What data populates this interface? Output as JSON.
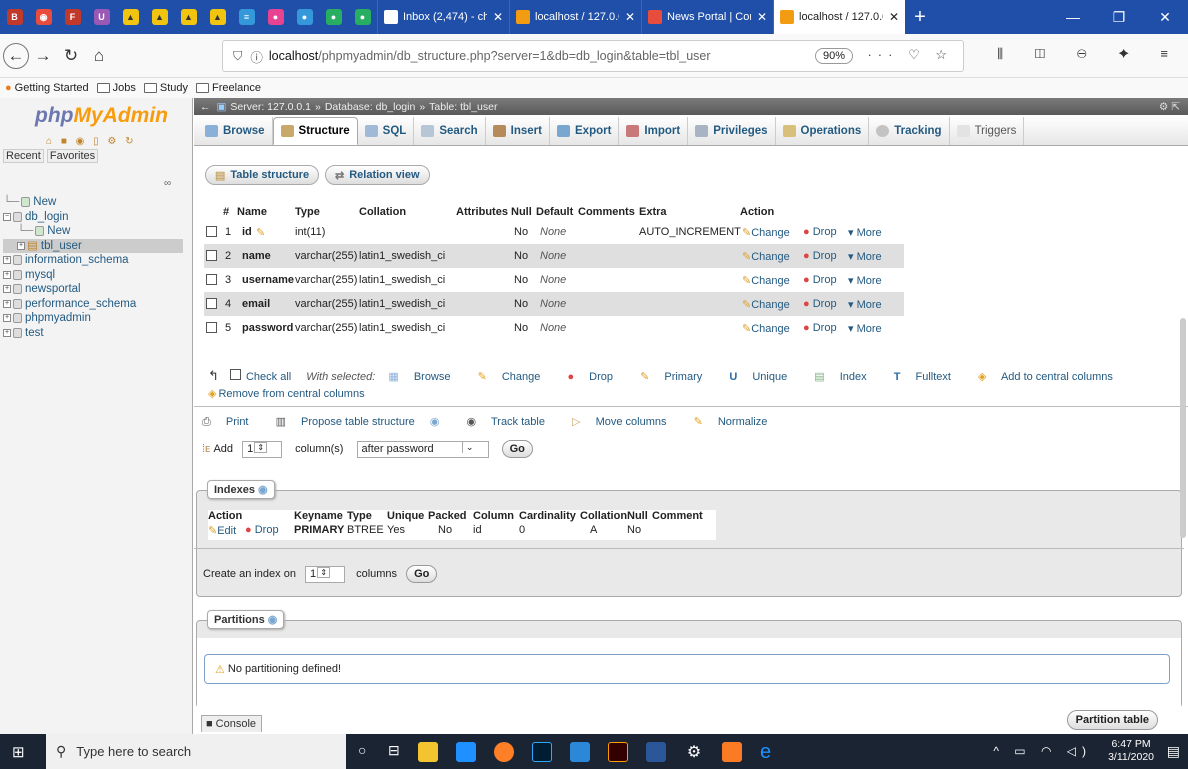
{
  "browser": {
    "tabs": [
      {
        "label": "Inbox (2,474) - ch",
        "color": "#ffffff"
      },
      {
        "label": "localhost / 127.0.0",
        "color": "#f39c12"
      },
      {
        "label": "News Portal | Con",
        "color": "#e74c3c"
      },
      {
        "label": "localhost / 127.0.0",
        "color": "#f39c12"
      }
    ],
    "url_host": "localhost",
    "url_path": "/phpmyadmin/db_structure.php?server=1&db=db_login&table=tbl_user",
    "zoom": "90%",
    "bookmarks": [
      "Getting Started",
      "Jobs",
      "Study",
      "Freelance"
    ]
  },
  "sidebar": {
    "logo_php": "php",
    "logo_myadmin": "MyAdmin",
    "recent": "Recent",
    "favorites": "Favorites",
    "tree": [
      "New",
      "db_login",
      "New",
      "tbl_user",
      "information_schema",
      "mysql",
      "newsportal",
      "performance_schema",
      "phpmyadmin",
      "test"
    ]
  },
  "breadcrumb": {
    "server": "Server: 127.0.0.1",
    "database": "Database: db_login",
    "table": "Table: tbl_user"
  },
  "menu": [
    "Browse",
    "Structure",
    "SQL",
    "Search",
    "Insert",
    "Export",
    "Import",
    "Privileges",
    "Operations",
    "Tracking",
    "Triggers"
  ],
  "subtabs": [
    "Table structure",
    "Relation view"
  ],
  "structure": {
    "headers": [
      "#",
      "Name",
      "Type",
      "Collation",
      "Attributes",
      "Null",
      "Default",
      "Comments",
      "Extra",
      "Action"
    ],
    "rows": [
      {
        "num": "1",
        "name": "id",
        "type": "int(11)",
        "collation": "",
        "null": "No",
        "default": "None",
        "extra": "AUTO_INCREMENT"
      },
      {
        "num": "2",
        "name": "name",
        "type": "varchar(255)",
        "collation": "latin1_swedish_ci",
        "null": "No",
        "default": "None",
        "extra": ""
      },
      {
        "num": "3",
        "name": "username",
        "type": "varchar(255)",
        "collation": "latin1_swedish_ci",
        "null": "No",
        "default": "None",
        "extra": ""
      },
      {
        "num": "4",
        "name": "email",
        "type": "varchar(255)",
        "collation": "latin1_swedish_ci",
        "null": "No",
        "default": "None",
        "extra": ""
      },
      {
        "num": "5",
        "name": "password",
        "type": "varchar(255)",
        "collation": "latin1_swedish_ci",
        "null": "No",
        "default": "None",
        "extra": ""
      }
    ],
    "action_change": "Change",
    "action_drop": "Drop",
    "action_more": "More"
  },
  "with_selected": {
    "check_all": "Check all",
    "label": "With selected:",
    "items": [
      "Browse",
      "Change",
      "Drop",
      "Primary",
      "Unique",
      "Index",
      "Fulltext",
      "Add to central columns"
    ],
    "remove": "Remove from central columns"
  },
  "tools": [
    "Print",
    "Propose table structure",
    "Track table",
    "Move columns",
    "Normalize"
  ],
  "add_columns": {
    "add": "Add",
    "count": "1",
    "columns_label": "column(s)",
    "position": "after password",
    "go": "Go"
  },
  "indexes": {
    "legend": "Indexes",
    "headers": [
      "Action",
      "Keyname",
      "Type",
      "Unique",
      "Packed",
      "Column",
      "Cardinality",
      "Collation",
      "Null",
      "Comment"
    ],
    "row": {
      "edit": "Edit",
      "drop": "Drop",
      "keyname": "PRIMARY",
      "type": "BTREE",
      "unique": "Yes",
      "packed": "No",
      "column": "id",
      "cardinality": "0",
      "collation": "A",
      "null": "No",
      "comment": ""
    },
    "create_label": "Create an index on",
    "create_count": "1",
    "create_suffix": "columns",
    "go": "Go"
  },
  "partitions": {
    "legend": "Partitions",
    "notice": "No partitioning defined!",
    "button": "Partition table"
  },
  "console": "Console",
  "taskbar": {
    "search_placeholder": "Type here to search",
    "time": "6:47 PM",
    "date": "3/11/2020"
  }
}
